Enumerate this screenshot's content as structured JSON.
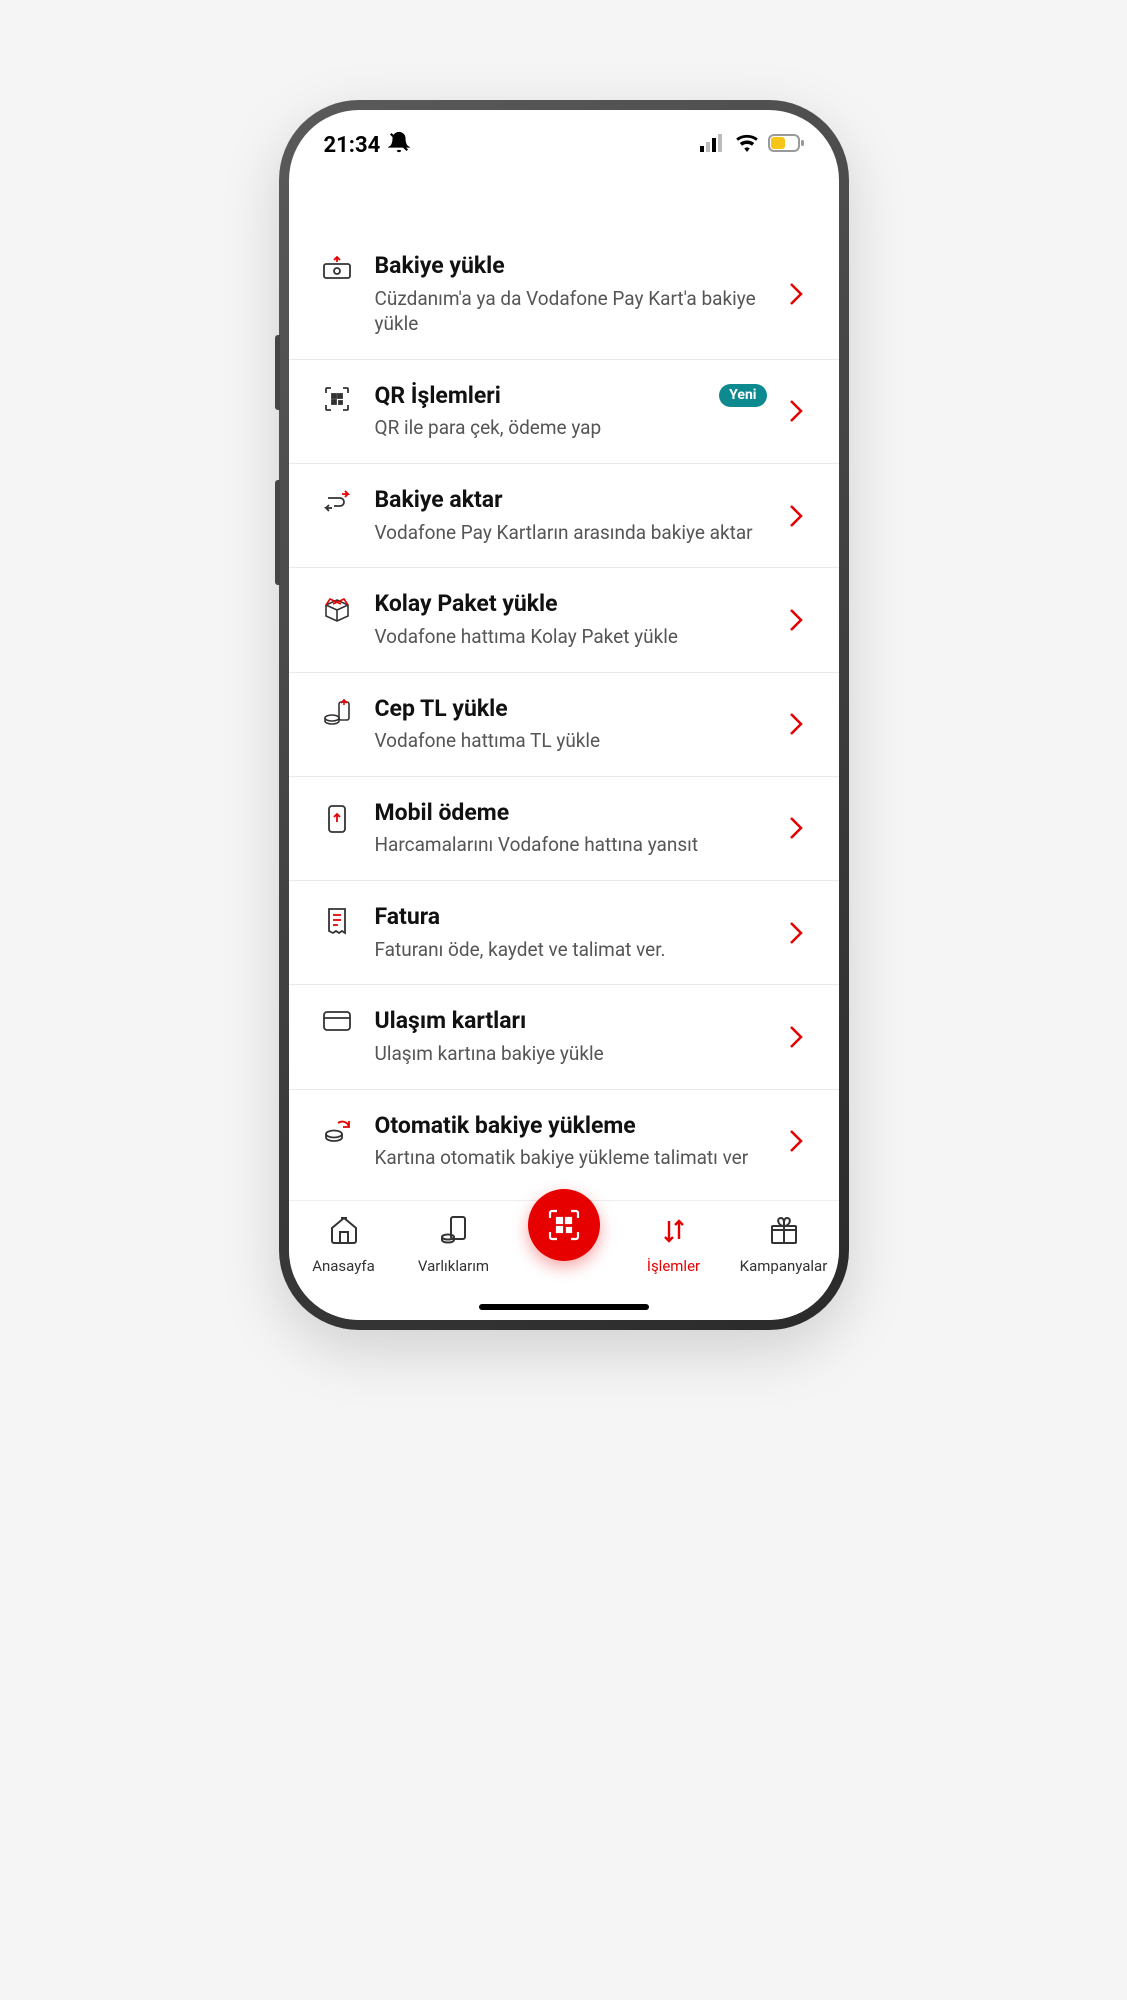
{
  "status": {
    "time": "21:34"
  },
  "list": [
    {
      "title": "Bakiye yükle",
      "sub": "Cüzdanım'a ya da Vodafone Pay Kart'a bakiye yükle",
      "icon": "money-up-icon",
      "badge": null
    },
    {
      "title": "QR İşlemleri",
      "sub": "QR ile para çek, ödeme yap",
      "icon": "qr-icon",
      "badge": "Yeni"
    },
    {
      "title": "Bakiye aktar",
      "sub": "Vodafone Pay Kartların arasında bakiye aktar",
      "icon": "transfer-icon",
      "badge": null
    },
    {
      "title": "Kolay Paket yükle",
      "sub": "Vodafone hattıma Kolay Paket yükle",
      "icon": "package-icon",
      "badge": null
    },
    {
      "title": "Cep TL yükle",
      "sub": "Vodafone hattıma TL yükle",
      "icon": "coins-up-icon",
      "badge": null
    },
    {
      "title": "Mobil ödeme",
      "sub": "Harcamalarını Vodafone hattına yansıt",
      "icon": "phone-up-icon",
      "badge": null
    },
    {
      "title": "Fatura",
      "sub": "Faturanı öde, kaydet ve talimat ver.",
      "icon": "invoice-icon",
      "badge": null
    },
    {
      "title": "Ulaşım kartları",
      "sub": "Ulaşım kartına bakiye yükle",
      "icon": "card-icon",
      "badge": null
    },
    {
      "title": "Otomatik bakiye yükleme",
      "sub": "Kartına otomatik bakiye yükleme talimatı ver",
      "icon": "auto-coins-icon",
      "badge": null
    }
  ],
  "tabs": [
    {
      "label": "Anasayfa",
      "active": false
    },
    {
      "label": "Varlıklarım",
      "active": false
    },
    {
      "label": "",
      "active": false,
      "qr": true
    },
    {
      "label": "İşlemler",
      "active": true
    },
    {
      "label": "Kampanyalar",
      "active": false
    }
  ],
  "colors": {
    "accent": "#e60000",
    "badge": "#0d8a8f"
  }
}
